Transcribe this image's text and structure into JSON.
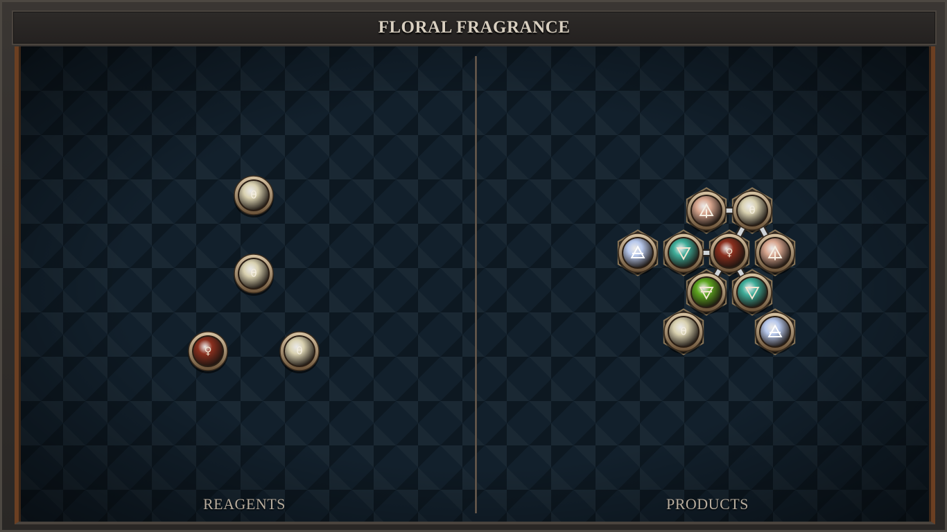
{
  "title": "FLORAL FRAGRANCE",
  "panels": {
    "reagents_label": "REAGENTS",
    "products_label": "PRODUCTS"
  },
  "colors": {
    "salt": "#d9d1b0",
    "copper": "#8a2f1e",
    "fire": "#d9a790",
    "water": "#3fae9a",
    "earth": "#5ea620",
    "air": "#b7c8ec",
    "rim": "#b89f80"
  },
  "reagents": [
    {
      "element": "salt",
      "symbol": "θ",
      "icon": "salt-icon"
    },
    {
      "element": "salt",
      "symbol": "θ",
      "icon": "salt-icon"
    },
    {
      "element": "copper",
      "symbol": "♀",
      "icon": "copper-icon"
    },
    {
      "element": "salt",
      "symbol": "θ",
      "icon": "salt-icon"
    }
  ],
  "product": {
    "atoms": [
      {
        "element": "fire",
        "symbol": "fire",
        "icon": "fire-icon"
      },
      {
        "element": "salt",
        "symbol": "θ",
        "icon": "salt-icon"
      },
      {
        "element": "air",
        "symbol": "air",
        "icon": "air-icon"
      },
      {
        "element": "water",
        "symbol": "water",
        "icon": "water-icon"
      },
      {
        "element": "copper",
        "symbol": "♀",
        "icon": "copper-icon"
      },
      {
        "element": "fire",
        "symbol": "fire",
        "icon": "fire-icon"
      },
      {
        "element": "earth",
        "symbol": "earth",
        "icon": "earth-icon"
      },
      {
        "element": "water",
        "symbol": "water",
        "icon": "water-icon"
      },
      {
        "element": "salt",
        "symbol": "θ",
        "icon": "salt-icon"
      },
      {
        "element": "air",
        "symbol": "air",
        "icon": "air-icon"
      }
    ],
    "bonds": [
      [
        0,
        1
      ],
      [
        1,
        4
      ],
      [
        1,
        5
      ],
      [
        3,
        4
      ],
      [
        4,
        6
      ],
      [
        4,
        7
      ]
    ]
  }
}
